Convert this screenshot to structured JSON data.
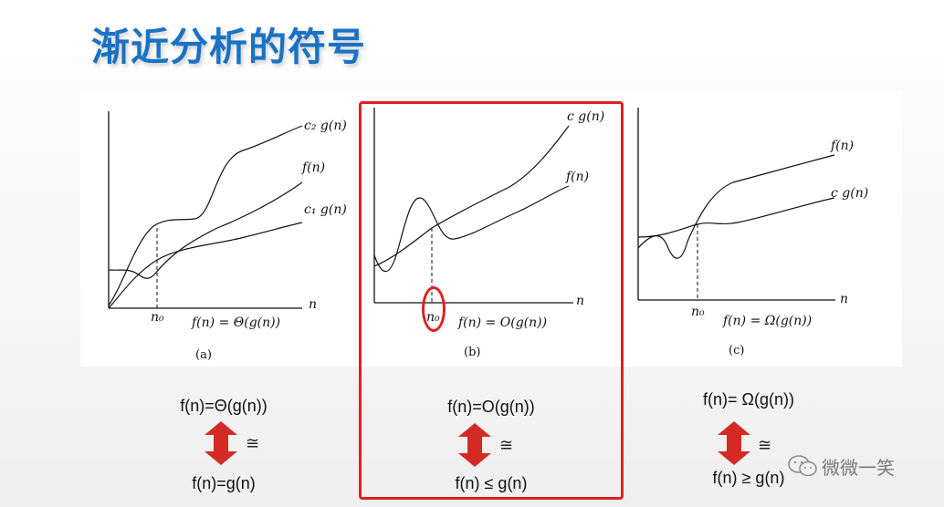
{
  "title": "渐近分析的符号",
  "graphs": [
    {
      "curves": [
        "c₂ g(n)",
        "f(n)",
        "c₁ g(n)"
      ],
      "axis_label": "n",
      "n0_label": "n₀",
      "formula": "f(n) = Θ(g(n))",
      "panel_label": "(a)"
    },
    {
      "curves": [
        "c g(n)",
        "f(n)"
      ],
      "axis_label": "n",
      "n0_label": "n₀",
      "formula": "f(n) = O(g(n))",
      "panel_label": "(b)"
    },
    {
      "curves": [
        "f(n)",
        "c g(n)"
      ],
      "axis_label": "n",
      "n0_label": "n₀",
      "formula": "f(n) = Ω(g(n))",
      "panel_label": "(c)"
    }
  ],
  "relations": [
    {
      "top": "f(n)=Θ(g(n))",
      "symbol": "≅",
      "bottom": "f(n)=g(n)"
    },
    {
      "top": "f(n)=O(g(n))",
      "symbol": "≅",
      "bottom": "f(n) ≤ g(n)"
    },
    {
      "top": "f(n)= Ω(g(n))",
      "symbol": "≅",
      "bottom": "f(n) ≥ g(n)"
    }
  ],
  "watermark": "微微一笑",
  "colors": {
    "title": "#1a72c4",
    "highlight": "#e02020",
    "arrow": "#d42a25"
  }
}
